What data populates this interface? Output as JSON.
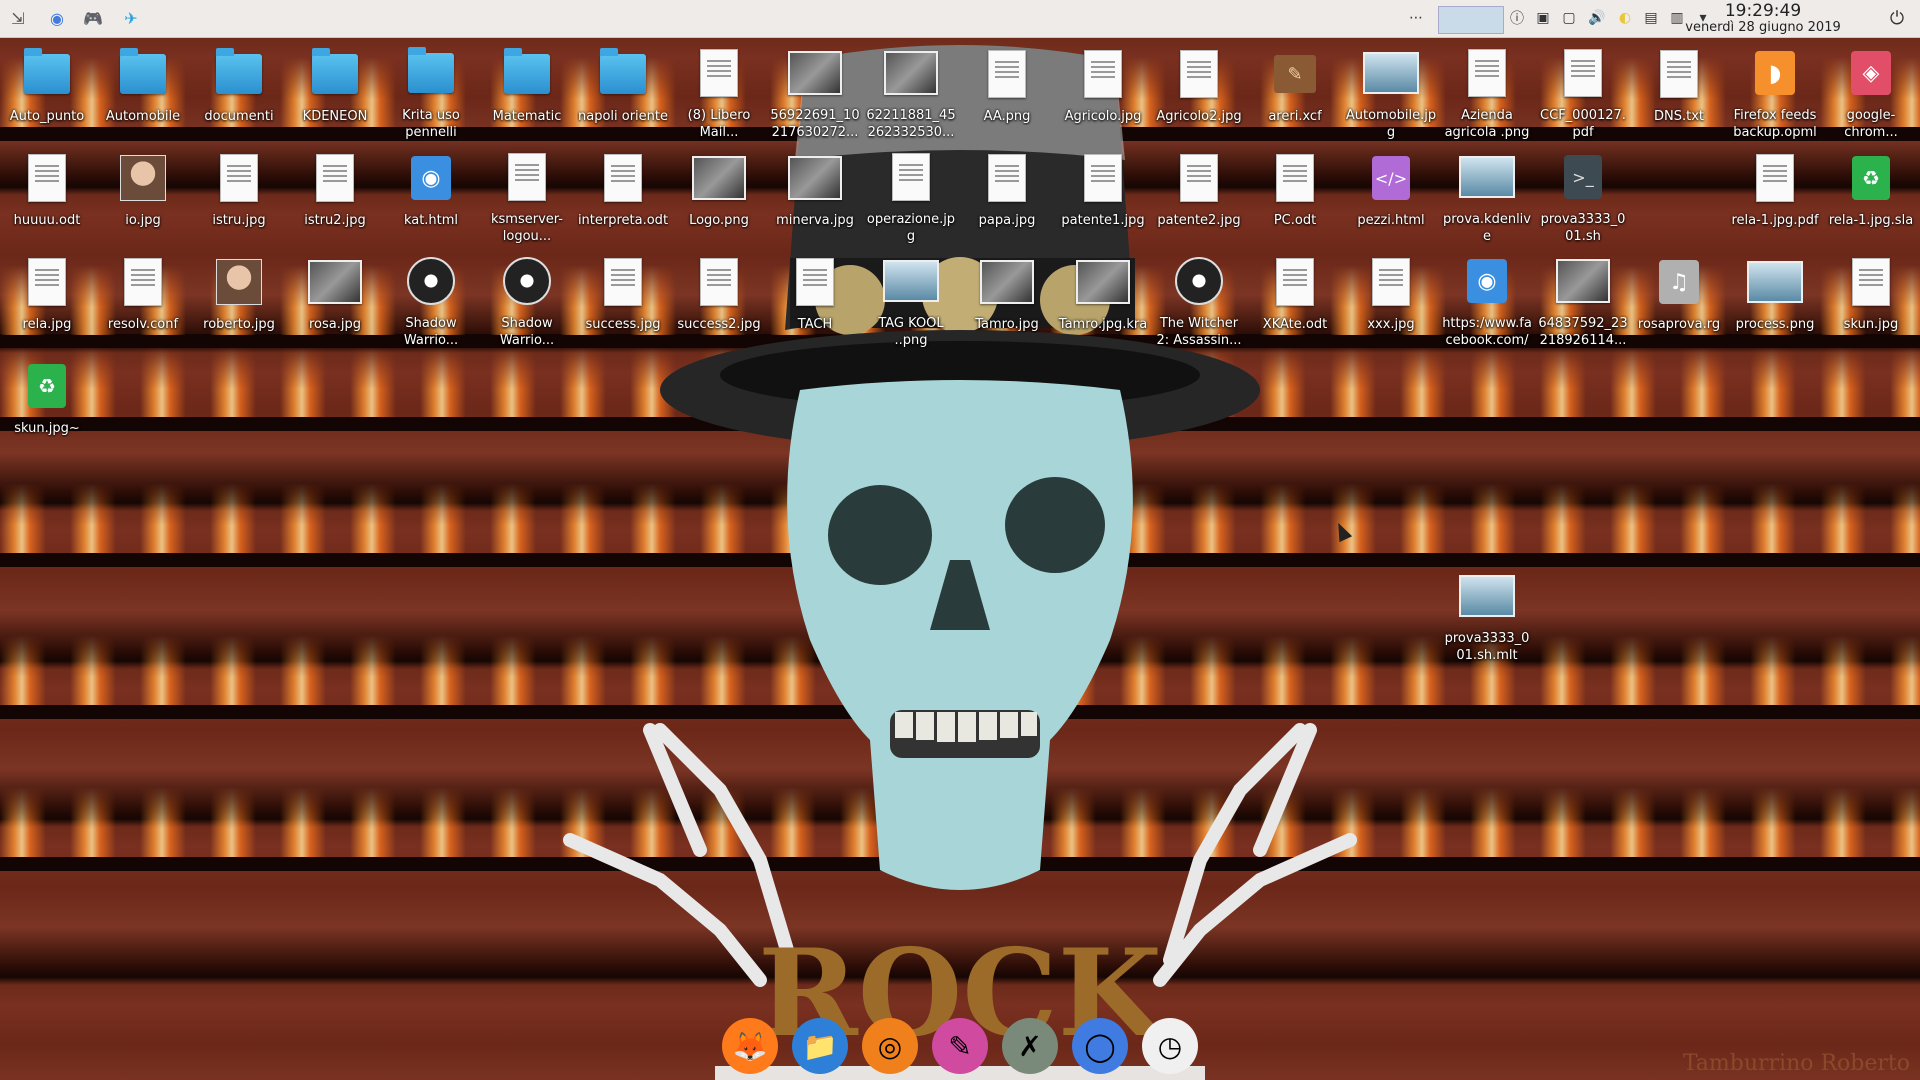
{
  "panel": {
    "launchers": [
      {
        "name": "application-launcher-icon",
        "glyph": "⇲"
      },
      {
        "name": "chromium-launcher-icon",
        "glyph": "◉"
      },
      {
        "name": "discord-launcher-icon",
        "glyph": "🎮"
      },
      {
        "name": "telegram-launcher-icon",
        "glyph": "✈"
      }
    ],
    "tray": [
      "⋯",
      "ⓘ",
      "▣",
      "▢",
      "🔊",
      "◐",
      "▤",
      "▥",
      "▾"
    ],
    "time": "19:29:49",
    "date": "venerdì 28 giugno 2019",
    "power_glyph": "⏻"
  },
  "desktop": {
    "icons": [
      {
        "label": "Auto_punto",
        "type": "folder"
      },
      {
        "label": "Automobile",
        "type": "folder"
      },
      {
        "label": "documenti",
        "type": "folder"
      },
      {
        "label": "KDENEON",
        "type": "folder"
      },
      {
        "label": "Krita uso pennelli",
        "type": "folder"
      },
      {
        "label": "Matematic",
        "type": "folder"
      },
      {
        "label": "napoli oriente",
        "type": "folder"
      },
      {
        "label": "(8) Libero Mail...",
        "type": "doc"
      },
      {
        "label": "56922691_10217630272...",
        "type": "photo"
      },
      {
        "label": "62211881_45262332530...",
        "type": "photo"
      },
      {
        "label": "AA.png",
        "type": "doc"
      },
      {
        "label": "Agricolo.jpg",
        "type": "doc"
      },
      {
        "label": "Agricolo2.jpg",
        "type": "doc"
      },
      {
        "label": "areri.xcf",
        "type": "xcf"
      },
      {
        "label": "Automobile.jpg",
        "type": "wide"
      },
      {
        "label": "Azienda agricola .png",
        "type": "doc"
      },
      {
        "label": "CCF_000127.pdf",
        "type": "doc"
      },
      {
        "label": "DNS.txt",
        "type": "doc"
      },
      {
        "label": "Firefox feeds backup.opml",
        "type": "rss"
      },
      {
        "label": "google-chrom...",
        "type": "chrome"
      },
      {
        "label": "huuuu.odt",
        "type": "doc"
      },
      {
        "label": "io.jpg",
        "type": "face"
      },
      {
        "label": "istru.jpg",
        "type": "doc"
      },
      {
        "label": "istru2.jpg",
        "type": "doc"
      },
      {
        "label": "kat.html",
        "type": "globe"
      },
      {
        "label": "ksmserver-logou...",
        "type": "doc"
      },
      {
        "label": "interpreta.odt",
        "type": "doc"
      },
      {
        "label": "Logo.png",
        "type": "photo"
      },
      {
        "label": "minerva.jpg",
        "type": "photo"
      },
      {
        "label": "operazione.jpg",
        "type": "doc"
      },
      {
        "label": "papa.jpg",
        "type": "doc"
      },
      {
        "label": "patente1.jpg",
        "type": "doc"
      },
      {
        "label": "patente2.jpg",
        "type": "doc"
      },
      {
        "label": "PC.odt",
        "type": "doc"
      },
      {
        "label": "pezzi.html",
        "type": "purple"
      },
      {
        "label": "prova.kdenlive",
        "type": "wide"
      },
      {
        "label": "prova3333_001.sh",
        "type": "term"
      },
      {
        "label": "rela-1.jpg.pdf",
        "type": "doc"
      },
      {
        "label": "rela-1.jpg.sla",
        "type": "green"
      },
      {
        "label": "rela.jpg",
        "type": "doc"
      },
      {
        "label": "resolv.conf",
        "type": "doc"
      },
      {
        "label": "roberto.jpg",
        "type": "face"
      },
      {
        "label": "rosa.jpg",
        "type": "photo"
      },
      {
        "label": "Shadow Warrio...",
        "type": "disc"
      },
      {
        "label": "Shadow Warrio...",
        "type": "disc"
      },
      {
        "label": "success.jpg",
        "type": "doc"
      },
      {
        "label": "success2.jpg",
        "type": "doc"
      },
      {
        "label": "TACH",
        "type": "doc"
      },
      {
        "label": "TAG KOOL ..png",
        "type": "wide"
      },
      {
        "label": "Tamro.jpg",
        "type": "photo"
      },
      {
        "label": "Tamro.jpg.kra",
        "type": "photo"
      },
      {
        "label": "The Witcher 2: Assassin...",
        "type": "disc"
      },
      {
        "label": "XKAte.odt",
        "type": "doc"
      },
      {
        "label": "xxx.jpg",
        "type": "doc"
      },
      {
        "label": "https:/www.facebook.com/",
        "type": "globe"
      },
      {
        "label": "64837592_23218926114...",
        "type": "photo"
      },
      {
        "label": "rosaprova.rg",
        "type": "music"
      },
      {
        "label": "process.png",
        "type": "wide"
      },
      {
        "label": "skun.jpg",
        "type": "doc"
      },
      {
        "label": "skun.jpg~",
        "type": "green"
      },
      {
        "label": "prova3333_001.sh.mlt",
        "type": "wide"
      }
    ]
  },
  "dock": {
    "items": [
      {
        "name": "firefox-icon",
        "glyph": "🦊",
        "bg": "#ff7a1a"
      },
      {
        "name": "files-icon",
        "glyph": "📁",
        "bg": "#2d7fd8"
      },
      {
        "name": "blender-icon",
        "glyph": "◎",
        "bg": "#f0801c"
      },
      {
        "name": "krita-icon",
        "glyph": "✎",
        "bg": "#d04aa0"
      },
      {
        "name": "xaos-icon",
        "glyph": "✗",
        "bg": "#7a8a7a"
      },
      {
        "name": "chromium-icon",
        "glyph": "◯",
        "bg": "#3f7be0"
      },
      {
        "name": "clock-icon",
        "glyph": "◷",
        "bg": "#f0f0f0"
      }
    ]
  },
  "wallpaper": {
    "text": "ROCK",
    "watermark": "Tamburrino Roberto"
  }
}
